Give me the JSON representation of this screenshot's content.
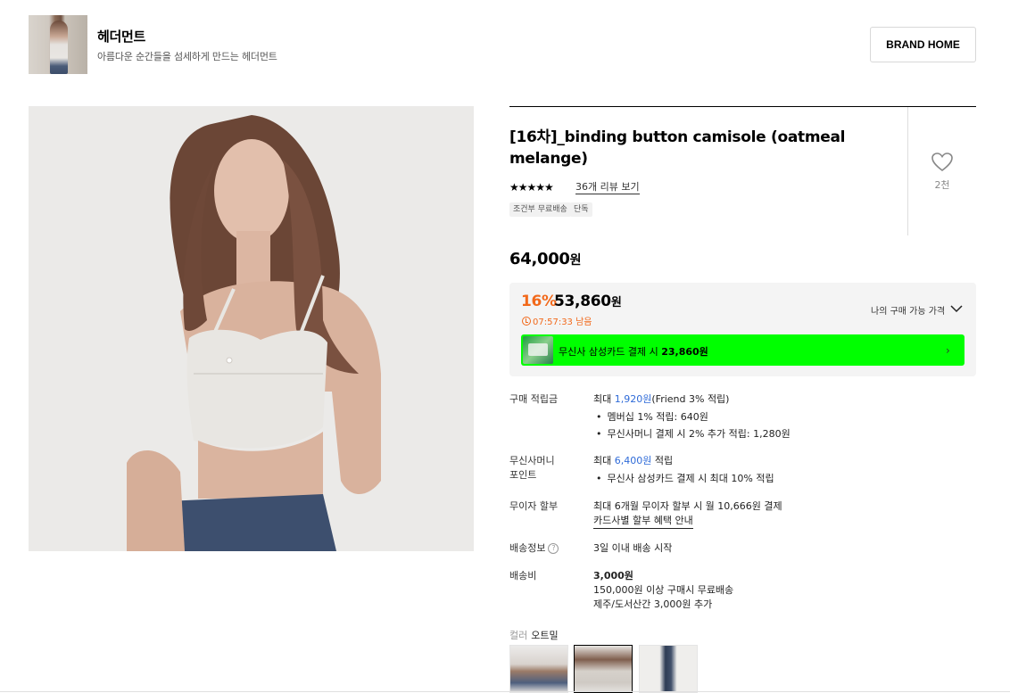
{
  "brand": {
    "name": "헤더먼트",
    "description": "아름다운 순간들을 섬세하게 만드는 헤더먼트",
    "home_button": "BRAND HOME"
  },
  "product": {
    "title": "[16차]_binding button camisole (oatmeal melange)",
    "rating_stars": "★★★★★",
    "review_link": "36개 리뷰 보기",
    "like_count": "2천",
    "tags": [
      "조건부 무료배송",
      "단독"
    ],
    "original_price": "64,000",
    "currency": "원"
  },
  "sale": {
    "discount": "16%",
    "price": "53,860",
    "currency": "원",
    "timer": "07:57:33 남음",
    "my_price_label": "나의 구매 가능 가격",
    "card_banner_prefix": "무신사 삼성카드 결제 시",
    "card_banner_price": "23,860원",
    "card_banner_bg": "#00ff00",
    "accent_color": "#f2691b"
  },
  "info": {
    "reward_label": "구매 적립금",
    "reward_prefix": "최대",
    "reward_amount": "1,920원",
    "reward_suffix": "(Friend 3% 적립)",
    "reward_bullets": [
      "멤버십 1% 적립: 640원",
      "무신사머니 결제 시 2% 추가 적립: 1,280원"
    ],
    "money_label_1": "무신사머니",
    "money_label_2": "포인트",
    "money_prefix": "최대",
    "money_amount": "6,400원",
    "money_suffix": "적립",
    "money_bullet": "무신사 삼성카드 결제 시 최대 10% 적립",
    "installment_label": "무이자 할부",
    "installment_value": "최대 6개월 무이자 할부 시 월 10,666원 결제",
    "installment_link": "카드사별 할부 혜택 안내",
    "shipping_label": "배송정보",
    "shipping_value": "3일 이내 배송 시작",
    "fee_label": "배송비",
    "fee_value": "3,000원",
    "fee_note_1": "150,000원 이상 구매시 무료배송",
    "fee_note_2": "제주/도서산간 3,000원 추가"
  },
  "color": {
    "label": "컬러",
    "value": "오트밀"
  }
}
